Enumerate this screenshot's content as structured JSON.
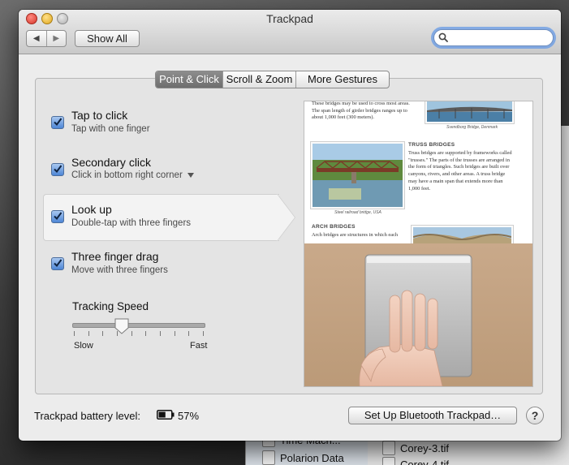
{
  "window": {
    "title": "Trackpad",
    "nav_back": "◀",
    "nav_forward": "▶",
    "show_all": "Show All",
    "search_value": "",
    "search_placeholder": ""
  },
  "tabs": [
    {
      "label": "Point & Click",
      "active": true
    },
    {
      "label": "Scroll & Zoom",
      "active": false
    },
    {
      "label": "More Gestures",
      "active": false
    }
  ],
  "options": [
    {
      "title": "Tap to click",
      "subtitle": "Tap with one finger",
      "checked": true,
      "selected": false
    },
    {
      "title": "Secondary click",
      "subtitle": "Click in bottom right corner",
      "checked": true,
      "selected": false,
      "has_dropdown": true
    },
    {
      "title": "Look up",
      "subtitle": "Double-tap with three fingers",
      "checked": true,
      "selected": true
    },
    {
      "title": "Three finger drag",
      "subtitle": "Move with three fingers",
      "checked": true,
      "selected": false
    }
  ],
  "tracking": {
    "title": "Tracking Speed",
    "min_label": "Slow",
    "max_label": "Fast",
    "level": 0.35,
    "tick_count": 10
  },
  "preview_doc": {
    "para1": "These bridges may be used to cross most areas. The span length of girder bridges ranges up to about 1,000 feet (300 meters).",
    "caption1": "Svendborg Bridge, Denmark",
    "heading_truss": "TRUSS BRIDGES",
    "para_truss": "Truss bridges are supported by frameworks called \"trusses.\" The parts of the trusses are arranged in the form of triangles. Such bridges are built over canyons, rivers, and other areas. A truss bridge may have a main span that extends more than 1,000 feet.",
    "caption2": "Steel railroad bridge, USA",
    "heading_arch": "ARCH BRIDGES",
    "para_arch": "Arch bridges are structures in which each"
  },
  "bottom": {
    "battery_label": "Trackpad battery level:",
    "battery_percent": "57%",
    "battery_level": 0.57,
    "setup_button": "Set Up Bluetooth Trackpad…",
    "help": "?"
  },
  "background": {
    "items": [
      {
        "label": "Time Mach..."
      },
      {
        "label": "Polarion Data"
      },
      {
        "label": "Corey-3.tif"
      },
      {
        "label": "Corey-4.tif"
      }
    ]
  },
  "colors": {
    "accent": "#4d86d6",
    "focus_ring": "#6699e6",
    "tab_active": "#7b7b7b"
  }
}
